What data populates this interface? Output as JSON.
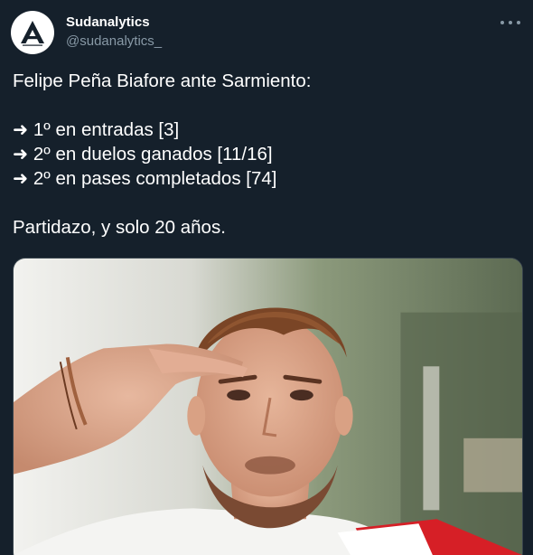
{
  "author": {
    "name": "Sudanalytics",
    "handle": "@sudanalytics_",
    "avatar_icon": "sudanalytics-logo-icon"
  },
  "menu_icon": "more-options-icon",
  "tweet": {
    "lines": [
      "Felipe Peña Biafore ante Sarmiento:",
      "➜ 1º en entradas [3]",
      "➜ 2º en duelos ganados [11/16]",
      "➜ 2º en pases completados [74]",
      "Partidazo, y solo 20 años."
    ]
  },
  "media": {
    "type": "photo",
    "accent_color": "#d61f26"
  },
  "colors": {
    "background": "#15202b",
    "text": "#ffffff",
    "secondary_text": "#8899a6",
    "border": "#38444d"
  }
}
